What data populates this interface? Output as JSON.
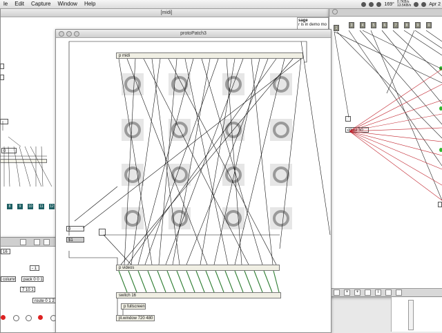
{
  "menubar": {
    "app_fragment": "le",
    "items": [
      "Edit",
      "Capture",
      "Window",
      "Help"
    ],
    "status": {
      "temp": "169°",
      "net_up": "0.7KB/s",
      "net_down": "13.5KB/s",
      "clock": "Apr 2"
    }
  },
  "midi_window": {
    "title": "[midi]"
  },
  "left_patch": {
    "zero_box": "0",
    "number_boxes": [
      "8",
      "9",
      "10",
      "11",
      "12"
    ],
    "lower": {
      "box16": "16",
      "minus1": "- 1",
      "column": "column",
      "pack": "pack 0 0 1",
      "seven": "7 10 1",
      "route": "route 0 1 2 3"
    }
  },
  "protopatch": {
    "title": "protoPatch3",
    "p_midi": "p midi",
    "p_videos": "p videos",
    "switch": "switch 16",
    "p_fullscreen": "p fullscreen",
    "jit_window": "jit.window 720 480",
    "zero_box": "0",
    "dollar1": "$1"
  },
  "right_window": {
    "message_fragment": "sage",
    "demo_text": "r is in demo mo",
    "top_boxes": [
      "1",
      "3",
      "4",
      "5",
      "6",
      "7",
      "8",
      "9",
      "0"
    ],
    "ctlout": "ctlout 30"
  },
  "colors": {
    "red_wire": "#c0202a",
    "green_wire": "#2e7d32",
    "accent": "#1d5f63"
  }
}
